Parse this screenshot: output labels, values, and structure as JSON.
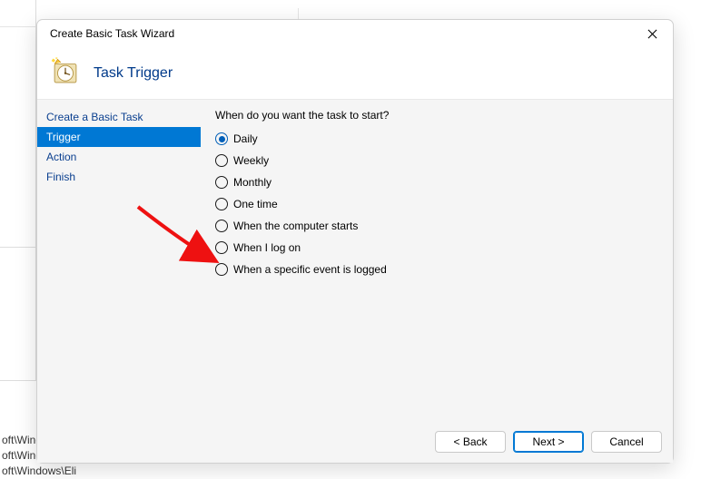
{
  "window_title": "Create Basic Task Wizard",
  "header_title": "Task Trigger",
  "steps": [
    {
      "label": "Create a Basic Task",
      "current": false
    },
    {
      "label": "Trigger",
      "current": true
    },
    {
      "label": "Action",
      "current": false
    },
    {
      "label": "Finish",
      "current": false
    }
  ],
  "question": "When do you want the task to start?",
  "options": [
    {
      "label": "Daily",
      "checked": true
    },
    {
      "label": "Weekly",
      "checked": false
    },
    {
      "label": "Monthly",
      "checked": false
    },
    {
      "label": "One time",
      "checked": false
    },
    {
      "label": "When the computer starts",
      "checked": false
    },
    {
      "label": "When I log on",
      "checked": false
    },
    {
      "label": "When a specific event is logged",
      "checked": false
    }
  ],
  "buttons": {
    "back": "< Back",
    "next": "Next >",
    "cancel": "Cancel"
  },
  "background_rows": [
    "oft\\Winc",
    "oft\\Windows\\U...",
    "oft\\Windows\\Eli"
  ]
}
